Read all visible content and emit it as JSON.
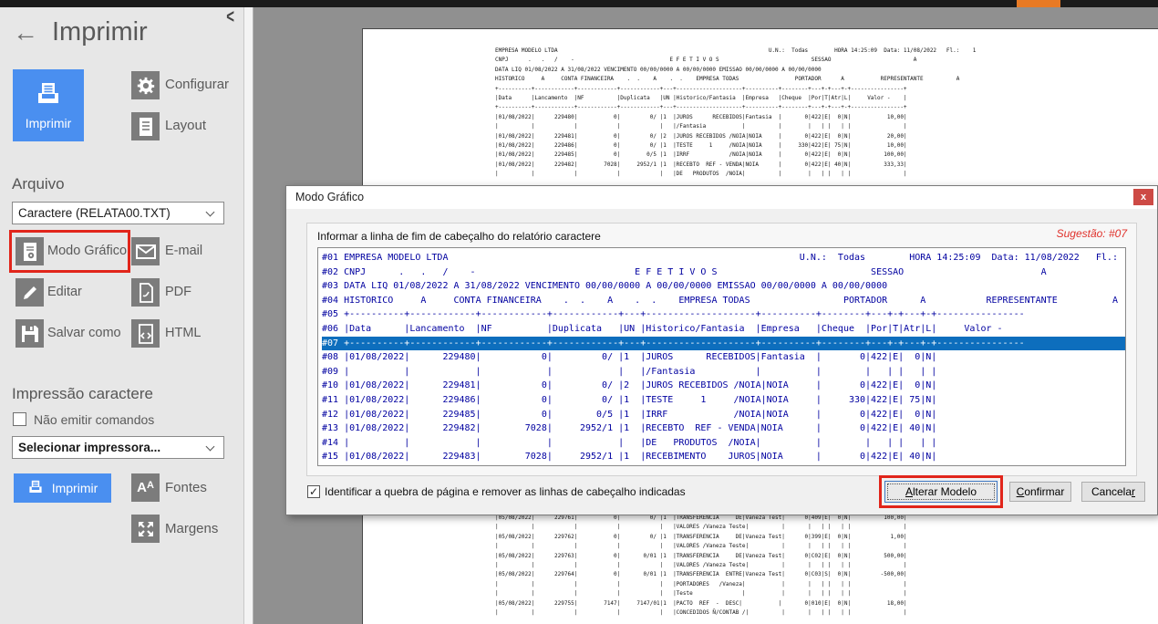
{
  "colors": {
    "accent_blue": "#4a8ff0",
    "icon_gray": "#7c7c7c",
    "highlight_red": "#e1251b",
    "modal_text_navy": "#0000a0",
    "selection_blue": "#0d6ebd",
    "close_red": "#cd4a45",
    "topbar_orange": "#e87a24"
  },
  "icons": {
    "back": "←",
    "collapse": "<",
    "check": "✓",
    "close": "x"
  },
  "sidebar": {
    "title": "Imprimir",
    "primary_print_label": "Imprimir",
    "configure_label": "Configurar",
    "layout_label": "Layout",
    "file_section": {
      "title": "Arquivo",
      "file_select_value": "Caractere (RELATA00.TXT)",
      "actions": [
        {
          "label": "Modo Gráfico",
          "icon": "document-gear-icon",
          "highlighted": true
        },
        {
          "label": "E-mail",
          "icon": "envelope-icon",
          "highlighted": false
        },
        {
          "label": "Editar",
          "icon": "pencil-icon",
          "highlighted": false
        },
        {
          "label": "PDF",
          "icon": "pdf-document-icon",
          "highlighted": false
        },
        {
          "label": "Salvar como",
          "icon": "floppy-disk-icon",
          "highlighted": false
        },
        {
          "label": "HTML",
          "icon": "code-document-icon",
          "highlighted": false
        }
      ]
    },
    "char_print_section": {
      "title": "Impressão caractere",
      "checkbox_label": "Não emitir comandos",
      "checkbox_checked": false,
      "printer_select_value": "Selecionar impressora...",
      "print_button_label": "Imprimir",
      "fonts_label": "Fontes",
      "margins_label": "Margens"
    }
  },
  "preview": {
    "top_lines": [
      "EMPRESA MODELO LTDA                                                                U.N.:  Todas        HORA 14:25:09  Data: 11/08/2022   Fl.:    1",
      "CNPJ      .   .   /    -                             E F E T I V O S                            SESSAO                         A",
      "DATA LIQ 01/08/2022 A 31/08/2022 VENCIMENTO 00/00/0000 A 00/00/0000 EMISSAO 00/00/0000 A 00/00/0000",
      "HISTORICO     A     CONTA FINANCEIRA    .  .    A    .  .    EMPRESA TODAS                 PORTADOR      A           REPRESENTANTE          A",
      "+----------+------------+------------+------------+---+--------------------+----------+--------+---+-+---+-+----------------+",
      "|Data      |Lancamento  |NF          |Duplicata   |UN |Historico/Fantasia  |Empresa   |Cheque  |Por|T|Atr|L|     Valor -    |",
      "+----------+------------+------------+------------+---+--------------------+----------+--------+---+-+---+-+----------------+",
      "|01/08/2022|      229480|           0|         0/ |1  |JUROS      RECEBIDOS|Fantasia  |       0|422|E|  0|N|           10,00|",
      "|          |            |            |            |   |/Fantasia           |          |        |   | |   | |                |",
      "|01/08/2022|      229481|           0|         0/ |2  |JUROS RECEBIDOS /NOIA|NOIA     |       0|422|E|  0|N|           20,00|",
      "|01/08/2022|      229486|           0|         0/ |1  |TESTE     1     /NOIA|NOIA     |     330|422|E| 75|N|           10,00|",
      "|01/08/2022|      229485|           0|        0/5 |1  |IRRF            /NOIA|NOIA     |       0|422|E|  0|N|          100,00|",
      "|01/08/2022|      229482|        7028|     2952/1 |1  |RECEBTO  REF - VENDA|NOIA      |       0|422|E| 40|N|          333,33|",
      "|          |            |            |            |   |DE   PRODUTOS  /NOIA|          |        |   | |   | |                |"
    ],
    "bottom_lines": [
      "|05/08/2022|      229761|           0|         0/ |1  |TRANSFERENCIA     DE|Vaneza Test|      0|409|E|  0|N|          100,00|",
      "|          |            |            |            |   |VALORES /Vaneza Teste|          |       |   | |   | |                |",
      "|05/08/2022|      229762|           0|         0/ |1  |TRANSFERENCIA     DE|Vaneza Test|      0|399|E|  0|N|            1,00|",
      "|          |            |            |            |   |VALORES /Vaneza Teste|          |       |   | |   | |                |",
      "|05/08/2022|      229763|           0|       0/01 |1  |TRANSFERENCIA     DE|Vaneza Test|      0|C02|E|  0|N|          500,00|",
      "|          |            |            |            |   |VALORES /Vaneza Teste|          |       |   | |   | |                |",
      "|05/08/2022|      229764|           0|       0/01 |1  |TRANSFERENCIA  ENTRE|Vaneza Test|      0|C03|S|  0|N|         -500,00|",
      "|          |            |            |            |   |PORTADORES   /Vaneza|           |       |   | |   | |                |",
      "|          |            |            |            |   |Teste               |           |       |   | |   | |                |",
      "|05/08/2022|      229755|        7147|     7147/01|1  |PACTO  REF  -  DESC|           |       0|010|E|  0|N|           18,00|",
      "|          |            |            |            |   |CONCEDIDOS Ñ/CONTAB /|          |       |   | |   | |                |"
    ]
  },
  "modal": {
    "title": "Modo Gráfico",
    "close_label": "x",
    "instruction": "Informar a linha de fim de cabeçalho do relatório caractere",
    "suggestion": "Sugestão: #07",
    "selected_line_index": 6,
    "lines": [
      "#01 EMPRESA MODELO LTDA                                                                U.N.:  Todas        HORA 14:25:09  Data: 11/08/2022   Fl.:",
      "#02 CNPJ      .   .   /    -                             E F E T I V O S                            SESSAO                         A",
      "#03 DATA LIQ 01/08/2022 A 31/08/2022 VENCIMENTO 00/00/0000 A 00/00/0000 EMISSAO 00/00/0000 A 00/00/0000",
      "#04 HISTORICO     A     CONTA FINANCEIRA    .  .    A    .  .    EMPRESA TODAS                 PORTADOR      A           REPRESENTANTE          A",
      "#05 +----------+------------+------------+------------+---+--------------------+----------+--------+---+-+---+-+----------------",
      "#06 |Data      |Lancamento  |NF          |Duplicata   |UN |Historico/Fantasia  |Empresa   |Cheque  |Por|T|Atr|L|     Valor -",
      "#07 +----------+------------+------------+------------+---+--------------------+----------+--------+---+-+---+-+----------------",
      "#08 |01/08/2022|      229480|           0|         0/ |1  |JUROS      RECEBIDOS|Fantasia  |       0|422|E|  0|N|",
      "#09 |          |            |            |            |   |/Fantasia           |          |        |   | |   | |",
      "#10 |01/08/2022|      229481|           0|         0/ |2  |JUROS RECEBIDOS /NOIA|NOIA     |       0|422|E|  0|N|",
      "#11 |01/08/2022|      229486|           0|         0/ |1  |TESTE     1     /NOIA|NOIA     |     330|422|E| 75|N|",
      "#12 |01/08/2022|      229485|           0|        0/5 |1  |IRRF            /NOIA|NOIA     |       0|422|E|  0|N|",
      "#13 |01/08/2022|      229482|        7028|     2952/1 |1  |RECEBTO  REF - VENDA|NOIA      |       0|422|E| 40|N|",
      "#14 |          |            |            |            |   |DE   PRODUTOS  /NOIA|          |        |   | |   | |",
      "#15 |01/08/2022|      229483|        7028|     2952/1 |1  |RECEBIMENTO    JUROS|NOIA      |       0|422|E| 40|N|"
    ],
    "footer_checkbox_label": "Identificar a quebra de página e remover as linhas de cabeçalho indicadas",
    "footer_checkbox_checked": true,
    "buttons": {
      "alter": {
        "pre": "",
        "key": "A",
        "post": "lterar Modelo"
      },
      "confirm": {
        "pre": "",
        "key": "C",
        "post": "onfirmar"
      },
      "cancel": {
        "pre": "Cancela",
        "key": "r",
        "post": ""
      }
    }
  }
}
